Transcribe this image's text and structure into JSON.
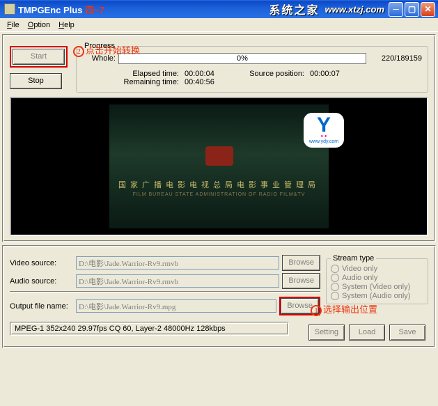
{
  "title": {
    "app": "TMPGEnc Plus",
    "suffix": "四~7"
  },
  "brand": {
    "cn": "系统之家",
    "url": "www.xtzj.com"
  },
  "menu": {
    "file": "File",
    "option": "Option",
    "help": "Help"
  },
  "buttons": {
    "start": "Start",
    "stop": "Stop",
    "browse": "Browse",
    "setting": "Setting",
    "load": "Load",
    "save": "Save"
  },
  "progress": {
    "legend": "Progress",
    "whole_label": "Whole:",
    "percent": "0%",
    "counter": "220/189159",
    "elapsed_label": "Elapsed time:",
    "elapsed_val": "00:00:04",
    "remaining_label": "Remaining time:",
    "remaining_val": "00:40:56",
    "srcpos_label": "Source position:",
    "srcpos_val": "00:00:07"
  },
  "annotations": {
    "a2_num": "2",
    "a2_text": "点击开始转换",
    "a1_num": "1",
    "a1_text": "选择输出位置"
  },
  "preview": {
    "logo_letter": "Y",
    "logo_url": "www.ydy.com",
    "line1": "国家广播电影电视总局电影事业管理局",
    "line2": "FILM BUREAU STATE ADMINISTRATION OF RADIO FILM&TV"
  },
  "form": {
    "video_label": "Video source:",
    "video_val": "D:\\电影\\Jade.Warrior-Rv9.rmvb",
    "audio_label": "Audio source:",
    "audio_val": "D:\\电影\\Jade.Warrior-Rv9.rmvb",
    "output_label": "Output file name:",
    "output_val": "D:\\电影\\Jade.Warrior-Rv9.mpg"
  },
  "stream": {
    "legend": "Stream type",
    "o1": "Video only",
    "o2": "Audio only",
    "o3": "System (Video only)",
    "o4": "System (Audio only)"
  },
  "status": "MPEG-1 352x240 29.97fps CQ 60,  Layer-2 48000Hz 128kbps"
}
